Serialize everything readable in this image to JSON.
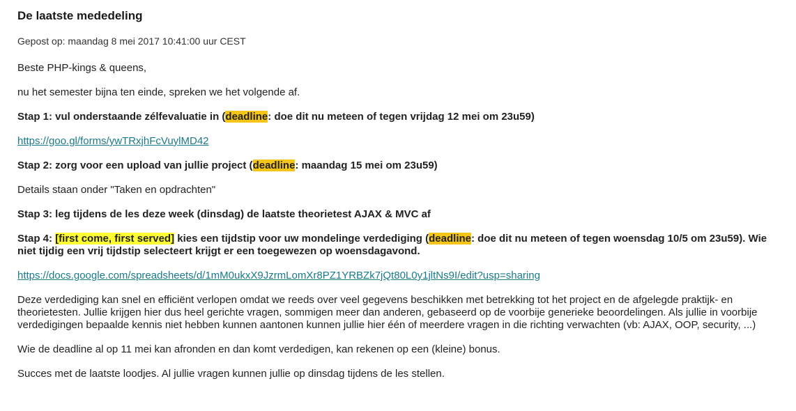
{
  "announcement": {
    "title": "De laatste mededeling",
    "posted": "Gepost op: maandag 8 mei 2017 10:41:00 uur CEST",
    "greeting": "Beste PHP-kings & queens,",
    "intro": "nu het semester bijna ten einde, spreken we het volgende af.",
    "step1": {
      "prefix": "Stap 1: vul onderstaande zélfevaluatie in (",
      "highlight": "deadline",
      "suffix": ": doe dit nu meteen of tegen vrijdag 12 mei om 23u59)"
    },
    "link1": "https://goo.gl/forms/ywTRxjhFcVuylMD42",
    "step2": {
      "prefix": "Stap 2: zorg voor een upload van jullie project (",
      "highlight": "deadline",
      "suffix": ": maandag 15 mei om 23u59)"
    },
    "details": "Details staan onder \"Taken en opdrachten\"",
    "step3": "Stap 3: leg tijdens de les deze week (dinsdag) de laatste theorietest AJAX & MVC af",
    "step4": {
      "prefix": "Stap 4: ",
      "tag": "[first come, first served]",
      "middle": " kies een tijdstip voor uw mondelinge verdediging (",
      "highlight": "deadline",
      "suffix": ": doe dit nu meteen of tegen woensdag 10/5 om 23u59). Wie niet tijdig een vrij tijdstip selecteert krijgt er een toegewezen op woensdagavond."
    },
    "link2": "https://docs.google.com/spreadsheets/d/1mM0ukxX9JzrmLomXr8PZ1YRBZk7jQt80L0y1jltNs9I/edit?usp=sharing",
    "paragraph": "Deze verdediging kan snel en efficiënt verlopen omdat we reeds over veel gegevens beschikken met betrekking tot het project en de afgelegde praktijk- en theorietesten. Jullie krijgen hier dus heel gerichte vragen, sommigen meer dan anderen, gebaseerd op de voorbije generieke beoordelingen. Als jullie in voorbije verdedigingen bepaalde kennis niet hebben kunnen aantonen kunnen jullie hier één of meerdere vragen in die richting verwachten (vb: AJAX, OOP, security, ...)",
    "bonus": "Wie de deadline al op 11 mei kan afronden en dan komt verdedigen, kan rekenen op een (kleine) bonus.",
    "closing": "Succes met de laatste loodjes. Al jullie vragen kunnen jullie op dinsdag tijdens de les stellen."
  },
  "colors": {
    "deadline_highlight": "#f5c518",
    "tag_highlight": "#ffff33",
    "link": "#1a7a8a"
  }
}
